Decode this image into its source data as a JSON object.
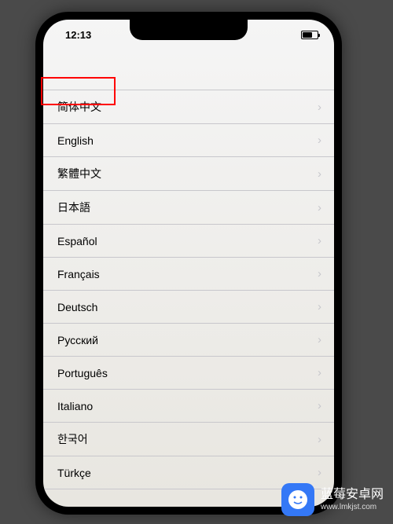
{
  "statusBar": {
    "time": "12:13"
  },
  "languages": [
    {
      "label": "简体中文"
    },
    {
      "label": "English"
    },
    {
      "label": "繁體中文"
    },
    {
      "label": "日本語"
    },
    {
      "label": "Español"
    },
    {
      "label": "Français"
    },
    {
      "label": "Deutsch"
    },
    {
      "label": "Русский"
    },
    {
      "label": "Português"
    },
    {
      "label": "Italiano"
    },
    {
      "label": "한국어"
    },
    {
      "label": "Türkçe"
    }
  ],
  "watermark": {
    "title": "蓝莓安卓网",
    "url": "www.lmkjst.com"
  }
}
